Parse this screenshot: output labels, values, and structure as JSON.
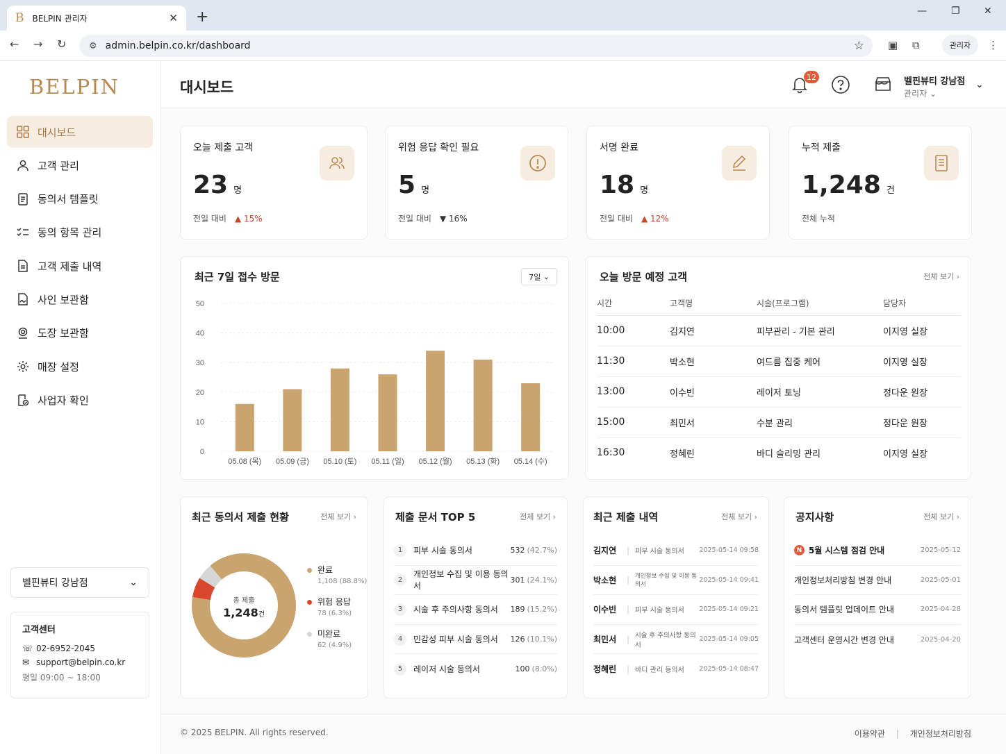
{
  "browser": {
    "tab_title": "BELPIN 관리자",
    "favicon": "B",
    "url": "admin.belpin.co.kr/dashboard",
    "profile": "관리자"
  },
  "sidebar": {
    "logo": "BELPIN",
    "items": [
      {
        "label": "대시보드",
        "icon": "grid-icon"
      },
      {
        "label": "고객 관리",
        "icon": "user-icon"
      },
      {
        "label": "동의서 템플릿",
        "icon": "document-icon"
      },
      {
        "label": "동의 항목 관리",
        "icon": "checklist-icon"
      },
      {
        "label": "고객 제출 내역",
        "icon": "file-list-icon"
      },
      {
        "label": "사인 보관함",
        "icon": "signature-icon"
      },
      {
        "label": "도장 보관함",
        "icon": "stamp-icon"
      },
      {
        "label": "매장 설정",
        "icon": "gear-icon"
      },
      {
        "label": "사업자 확인",
        "icon": "business-check-icon"
      }
    ],
    "store_select": "벨핀뷰티 강남점",
    "cs": {
      "title": "고객센터",
      "phone": "02-6952-2045",
      "email": "support@belpin.co.kr",
      "hours": "평일 09:00 ~ 18:00"
    }
  },
  "header": {
    "title": "대시보드",
    "notif_count": "12",
    "store_name": "벨핀뷰티 강남점",
    "role": "관리자"
  },
  "kpis": [
    {
      "label": "오늘 제출 고객",
      "value": "23",
      "unit": "명",
      "foot": "전일 대비",
      "change": "15%",
      "dir": "up",
      "icon": "users-icon"
    },
    {
      "label": "위험 응답 확인 필요",
      "value": "5",
      "unit": "명",
      "foot": "전일 대비",
      "change": "16%",
      "dir": "down",
      "icon": "alert-icon"
    },
    {
      "label": "서명 완료",
      "value": "18",
      "unit": "명",
      "foot": "전일 대비",
      "change": "12%",
      "dir": "up",
      "icon": "pen-icon"
    },
    {
      "label": "누적 제출",
      "value": "1,248",
      "unit": "건",
      "foot": "전체 누적",
      "change": "",
      "dir": "",
      "icon": "document-icon"
    }
  ],
  "visits": {
    "title": "최근 7일 접수 방문",
    "range": "7일"
  },
  "chart_data": {
    "type": "bar",
    "title": "최근 7일 접수 방문",
    "categories": [
      "05.08 (목)",
      "05.09 (금)",
      "05.10 (토)",
      "05.11 (일)",
      "05.12 (월)",
      "05.13 (화)",
      "05.14 (수)"
    ],
    "values": [
      16,
      21,
      28,
      26,
      34,
      31,
      23
    ],
    "ylim": [
      0,
      50
    ],
    "yticks": [
      0,
      10,
      20,
      30,
      40,
      50
    ],
    "color": "#c9a46e",
    "grid": true
  },
  "schedule": {
    "title": "오늘 방문 예정 고객",
    "more": "전체 보기",
    "headers": [
      "시간",
      "고객명",
      "시술(프로그램)",
      "담당자"
    ],
    "rows": [
      [
        "10:00",
        "김지연",
        "피부관리 - 기본 관리",
        "이지영 실장"
      ],
      [
        "11:30",
        "박소현",
        "여드름 집중 케어",
        "이지영 실장"
      ],
      [
        "13:00",
        "이수빈",
        "레이저 토닝",
        "정다운 원장"
      ],
      [
        "15:00",
        "최민서",
        "수분 관리",
        "정다운 원장"
      ],
      [
        "16:30",
        "정혜린",
        "바디 슬리밍 관리",
        "이지영 실장"
      ]
    ]
  },
  "consent_status": {
    "title": "최근 동의서 제출 현황",
    "more": "전체 보기",
    "center_label": "총 제출",
    "total": "1,248",
    "total_unit": "건",
    "segments": [
      {
        "label": "완료",
        "value": 1108,
        "text": "1,108 (88.8%)",
        "color": "#c9a46e"
      },
      {
        "label": "위험 응답",
        "value": 78,
        "text": "78 (6.3%)",
        "color": "#d9472d"
      },
      {
        "label": "미완료",
        "value": 62,
        "text": "62 (4.9%)",
        "color": "#d6d6d6"
      }
    ]
  },
  "top5": {
    "title": "제출 문서 TOP 5",
    "more": "전체 보기",
    "items": [
      {
        "rank": "1",
        "name": "피부 시술 동의서",
        "count": "532",
        "pct": "(42.7%)"
      },
      {
        "rank": "2",
        "name": "개인정보 수집 및 이용 동의서",
        "count": "301",
        "pct": "(24.1%)"
      },
      {
        "rank": "3",
        "name": "시술 후 주의사항 동의서",
        "count": "189",
        "pct": "(15.2%)"
      },
      {
        "rank": "4",
        "name": "민감성 피부 시술 동의서",
        "count": "126",
        "pct": "(10.1%)"
      },
      {
        "rank": "5",
        "name": "레이저 시술 동의서",
        "count": "100",
        "pct": "(8.0%)"
      }
    ]
  },
  "recent": {
    "title": "최근 제출 내역",
    "more": "전체 보기",
    "items": [
      {
        "name": "김지연",
        "doc": "피부 시술 동의서",
        "date": "2025-05-14 09:58"
      },
      {
        "name": "박소현",
        "doc": "개인정보 수집 및 이용 동의서",
        "date": "2025-05-14 09:41"
      },
      {
        "name": "이수빈",
        "doc": "피부 시술 동의서",
        "date": "2025-05-14 09:21"
      },
      {
        "name": "최민서",
        "doc": "시술 후 주의사항 동의서",
        "date": "2025-05-14 09:05"
      },
      {
        "name": "정혜린",
        "doc": "바디 관리 동의서",
        "date": "2025-05-14 08:47"
      }
    ]
  },
  "notices": {
    "title": "공지사항",
    "more": "전체 보기",
    "items": [
      {
        "badge": "N",
        "text": "5월 시스템 점검 안내",
        "date": "2025-05-12"
      },
      {
        "badge": "",
        "text": "개인정보처리방침 변경 안내",
        "date": "2025-05-01"
      },
      {
        "badge": "",
        "text": "동의서 템플릿 업데이트 안내",
        "date": "2025-04-28"
      },
      {
        "badge": "",
        "text": "고객센터 운영시간 변경 안내",
        "date": "2025-04-20"
      }
    ]
  },
  "footer": {
    "copyright": "© 2025 BELPIN. All rights reserved.",
    "terms": "이용약관",
    "privacy": "개인정보처리방침"
  }
}
